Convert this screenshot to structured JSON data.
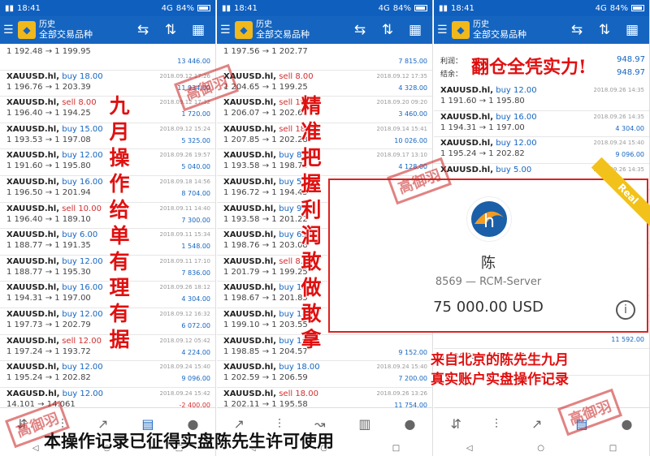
{
  "status": {
    "time": "18:41",
    "battery": "84%",
    "signal": "4G"
  },
  "appbar": {
    "title": "历史",
    "subtitle": "全部交易品种"
  },
  "icons": {
    "menu": "menu-icon",
    "currency": "currency-exchange-icon",
    "sort": "sort-icon",
    "calendar": "calendar-icon"
  },
  "panel1": [
    {
      "sym": "",
      "dir": "",
      "prices": "1 192.48 → 1 199.95",
      "date": "",
      "profit": "13 446.00"
    },
    {
      "sym": "XAUUSD.hl,",
      "dir": "buy 18.00",
      "prices": "1 196.76 → 1 203.39",
      "date": "2018.09.12 17:26",
      "profit": "11 934.00"
    },
    {
      "sym": "XAUUSD.hl,",
      "dir": "sell 8.00",
      "prices": "1 196.40 → 1 194.25",
      "date": "2018.09.12 17:32",
      "profit": "1 720.00"
    },
    {
      "sym": "XAUUSD.hl,",
      "dir": "buy 15.00",
      "prices": "1 193.53 → 1 197.08",
      "date": "2018.09.12 15:24",
      "profit": "5 325.00"
    },
    {
      "sym": "XAUUSD.hl,",
      "dir": "buy 12.00",
      "prices": "1 191.60 → 1 195.80",
      "date": "2018.09.26 19:57",
      "profit": "5 040.00"
    },
    {
      "sym": "XAUUSD.hl,",
      "dir": "buy 16.00",
      "prices": "1 196.50 → 1 201.94",
      "date": "2018.09.18 14:56",
      "profit": "8 704.00"
    },
    {
      "sym": "XAUUSD.hl,",
      "dir": "sell 10.00",
      "prices": "1 196.40 → 1 189.10",
      "date": "2018.09.11 14:40",
      "profit": "7 300.00"
    },
    {
      "sym": "XAUUSD.hl,",
      "dir": "buy 6.00",
      "prices": "1 188.77 → 1 191.35",
      "date": "2018.09.11 15:34",
      "profit": "1 548.00"
    },
    {
      "sym": "XAUUSD.hl,",
      "dir": "buy 12.00",
      "prices": "1 188.77 → 1 195.30",
      "date": "2018.09.11 17:10",
      "profit": "7 836.00"
    },
    {
      "sym": "XAUUSD.hl,",
      "dir": "buy 16.00",
      "prices": "1 194.31 → 1 197.00",
      "date": "2018.09.26 18:12",
      "profit": "4 304.00"
    },
    {
      "sym": "XAUUSD.hl,",
      "dir": "buy 12.00",
      "prices": "1 197.73 → 1 202.79",
      "date": "2018.09.12 16:32",
      "profit": "6 072.00"
    },
    {
      "sym": "XAUUSD.hl,",
      "dir": "sell 12.00",
      "prices": "1 197.24 → 1 193.72",
      "date": "2018.09.12 05:42",
      "profit": "4 224.00"
    },
    {
      "sym": "XAUUSD.hl,",
      "dir": "buy 12.00",
      "prices": "1 195.24 → 1 202.82",
      "date": "2018.09.24 15:40",
      "profit": "9 096.00"
    },
    {
      "sym": "XAGUSD.hl,",
      "dir": "buy 12.00",
      "prices": "14.101 → 14.061",
      "date": "2018.09.24 15:42",
      "profit": "-2 400.00"
    }
  ],
  "panel2": [
    {
      "sym": "",
      "dir": "",
      "prices": "1 197.56 → 1 202.77",
      "date": "",
      "profit": "7 815.00"
    },
    {
      "sym": "XAUUSD.hl,",
      "dir": "sell 8.00",
      "prices": "1 204.65 → 1 199.25",
      "date": "2018.09.12 17:35",
      "profit": "4 328.00"
    },
    {
      "sym": "XAUUSD.hl,",
      "dir": "sell 10.00",
      "prices": "1 206.07 → 1 202.61",
      "date": "2018.09.20 09:20",
      "profit": "3 460.00"
    },
    {
      "sym": "XAUUSD.hl,",
      "dir": "sell 18.00",
      "prices": "1 207.85 → 1 202.28",
      "date": "2018.09.14 15:41",
      "profit": "10 026.00"
    },
    {
      "sym": "XAUUSD.hl,",
      "dir": "buy 8.00",
      "prices": "1 193.58 → 1 198.74",
      "date": "2018.09.17 13:10",
      "profit": "4 128.00"
    },
    {
      "sym": "XAUUSD.hl,",
      "dir": "buy 5.00",
      "prices": "1 196.72 → 1 194.45",
      "date": "2018.09.26 14:35",
      "profit": ""
    },
    {
      "sym": "XAUUSD.hl,",
      "dir": "buy 9.00",
      "prices": "1 193.58 → 1 201.22",
      "date": "",
      "profit": ""
    },
    {
      "sym": "XAUUSD.hl,",
      "dir": "buy 6.00",
      "prices": "1 198.76 → 1 203.08",
      "date": "",
      "profit": ""
    },
    {
      "sym": "XAUUSD.hl,",
      "dir": "sell 8.00",
      "prices": "1 201.79 → 1 199.25",
      "date": "",
      "profit": ""
    },
    {
      "sym": "XAUUSD.hl,",
      "dir": "buy 18.00",
      "prices": "1 198.67 → 1 201.85",
      "date": "",
      "profit": ""
    },
    {
      "sym": "XAUUSD.hl,",
      "dir": "buy 18.00",
      "prices": "1 199.10 → 1 203.55",
      "date": "",
      "profit": ""
    },
    {
      "sym": "XAUUSD.hl,",
      "dir": "buy 16.00",
      "prices": "1 198.85 → 1 204.57",
      "date": "",
      "profit": "9 152.00"
    },
    {
      "sym": "XAUUSD.hl,",
      "dir": "buy 18.00",
      "prices": "1 202.59 → 1 206.59",
      "date": "2018.09.24 15:40",
      "profit": "7 200.00"
    },
    {
      "sym": "XAUUSD.hl,",
      "dir": "sell 18.00",
      "prices": "1 202.11 → 1 195.58",
      "date": "2018.09.26 13:26",
      "profit": "11 754.00"
    }
  ],
  "panel3_summary": {
    "label1": "利润：",
    "label2": "结余：",
    "value1": "948.97",
    "value2": "948.97"
  },
  "panel3": [
    {
      "sym": "XAUUSD.hl,",
      "dir": "buy 12.00",
      "prices": "1 191.60 → 1 195.80",
      "date": "2018.09.26 14:35",
      "profit": ""
    },
    {
      "sym": "XAUUSD.hl,",
      "dir": "buy 16.00",
      "prices": "1 194.31 → 1 197.00",
      "date": "2018.09.26 14:35",
      "profit": "4 304.00"
    },
    {
      "sym": "XAUUSD.hl,",
      "dir": "buy 12.00",
      "prices": "1 195.24 → 1 202.82",
      "date": "2018.09.24 15:40",
      "profit": "9 096.00"
    },
    {
      "sym": "XAUUSD.hl,",
      "dir": "buy 5.00",
      "prices": "",
      "date": "2018.09.26 14:35",
      "profit": ""
    },
    {
      "sym": "",
      "dir": "",
      "prices": "",
      "date": "",
      "profit": ""
    },
    {
      "sym": "",
      "dir": "",
      "prices": "",
      "date": "",
      "profit": ""
    },
    {
      "sym": "",
      "dir": "",
      "prices": "",
      "date": "",
      "profit": ""
    },
    {
      "sym": "",
      "dir": "",
      "prices": "",
      "date": "",
      "profit": ""
    },
    {
      "sym": "",
      "dir": "",
      "prices": "",
      "date": "",
      "profit": ""
    },
    {
      "sym": "",
      "dir": "",
      "prices": "",
      "date": "",
      "profit": "11 592.00"
    },
    {
      "sym": "",
      "dir": "",
      "prices": "1 184.83 → 1 191.27",
      "date": "",
      "profit": ""
    }
  ],
  "card": {
    "name": "陈 ",
    "account": "8569  — RCM-Server",
    "balance": "75 000.00 USD",
    "ribbon": "Real"
  },
  "callouts": {
    "panel1": "九月操作给单有理有据",
    "panel2": "精准把握利润敢做敢拿",
    "top": "翻仓全凭实力!",
    "bottom_line1": "来自北京的陈先生九月",
    "bottom_line2": "真实账户实盘操作记录",
    "caption": "本操作记录已征得实盘陈先生许可使用"
  },
  "watermark": "高御羽"
}
